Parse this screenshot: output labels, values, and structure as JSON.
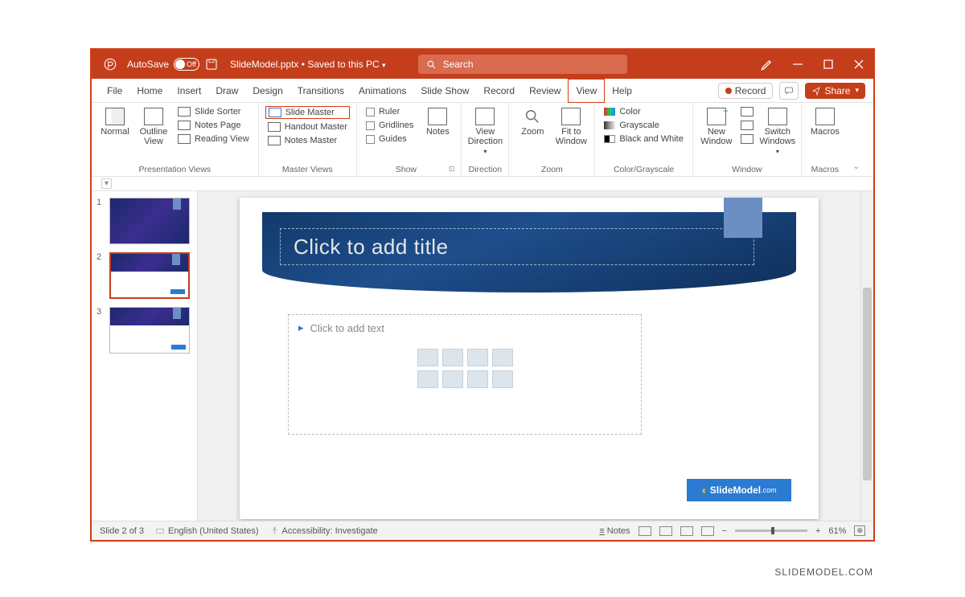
{
  "titlebar": {
    "autosave_label": "AutoSave",
    "autosave_state": "Off",
    "filename": "SlideModel.pptx",
    "save_status": "Saved to this PC",
    "search_placeholder": "Search"
  },
  "tabs": {
    "items": [
      "File",
      "Home",
      "Insert",
      "Draw",
      "Design",
      "Transitions",
      "Animations",
      "Slide Show",
      "Record",
      "Review",
      "View",
      "Help"
    ],
    "active": "View",
    "record_button": "Record",
    "share_button": "Share"
  },
  "ribbon": {
    "presentation_views": {
      "label": "Presentation Views",
      "normal": "Normal",
      "outline": "Outline View",
      "slide_sorter": "Slide Sorter",
      "notes_page": "Notes Page",
      "reading_view": "Reading View"
    },
    "master_views": {
      "label": "Master Views",
      "slide_master": "Slide Master",
      "handout_master": "Handout Master",
      "notes_master": "Notes Master"
    },
    "show": {
      "label": "Show",
      "ruler": "Ruler",
      "gridlines": "Gridlines",
      "guides": "Guides",
      "notes": "Notes"
    },
    "direction": {
      "label": "Direction",
      "view_direction": "View Direction"
    },
    "zoom": {
      "label": "Zoom",
      "zoom": "Zoom",
      "fit": "Fit to Window"
    },
    "color": {
      "label": "Color/Grayscale",
      "color": "Color",
      "grayscale": "Grayscale",
      "bw": "Black and White"
    },
    "window": {
      "label": "Window",
      "new_window": "New Window",
      "switch": "Switch Windows"
    },
    "macros": {
      "label": "Macros",
      "macros": "Macros"
    }
  },
  "thumbnails": {
    "count": 3,
    "selected": 2
  },
  "slide": {
    "title_placeholder": "Click to add title",
    "body_placeholder": "Click to add text",
    "logo_text": "SlideModel",
    "logo_suffix": ".com"
  },
  "statusbar": {
    "slide_counter": "Slide 2 of 3",
    "language": "English (United States)",
    "accessibility": "Accessibility: Investigate",
    "notes": "Notes",
    "zoom": "61%"
  },
  "attribution": "SLIDEMODEL.COM"
}
